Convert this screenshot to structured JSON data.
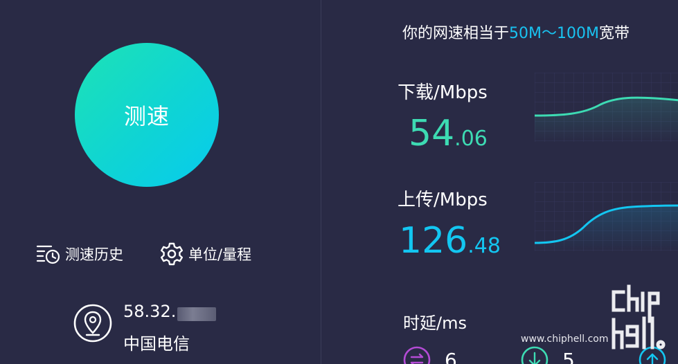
{
  "test": {
    "button_label": "测速"
  },
  "tools": {
    "history_label": "测速历史",
    "unit_label": "单位/量程"
  },
  "network": {
    "ip_visible": "58.32.",
    "isp": "中国电信"
  },
  "summary": {
    "prefix": "你的网速相当于",
    "range": "50M～100M",
    "suffix": "宽带"
  },
  "download": {
    "label": "下载/Mbps",
    "integer": "54",
    "decimal": ".06",
    "color": "#3ddbb3"
  },
  "upload": {
    "label": "上传/Mbps",
    "integer": "126",
    "decimal": ".48",
    "color": "#13c6f1"
  },
  "latency": {
    "label": "时延/ms",
    "items": [
      {
        "icon": "swap-icon",
        "value": "6",
        "color": "#b44bd6"
      },
      {
        "icon": "download-icon",
        "value": "5",
        "color": "#3ddbb3"
      },
      {
        "icon": "upload-icon",
        "value": "",
        "color": "#13c6f1"
      }
    ]
  },
  "watermark": {
    "url": "www.chiphell.com",
    "logo_text": "chip hell"
  }
}
